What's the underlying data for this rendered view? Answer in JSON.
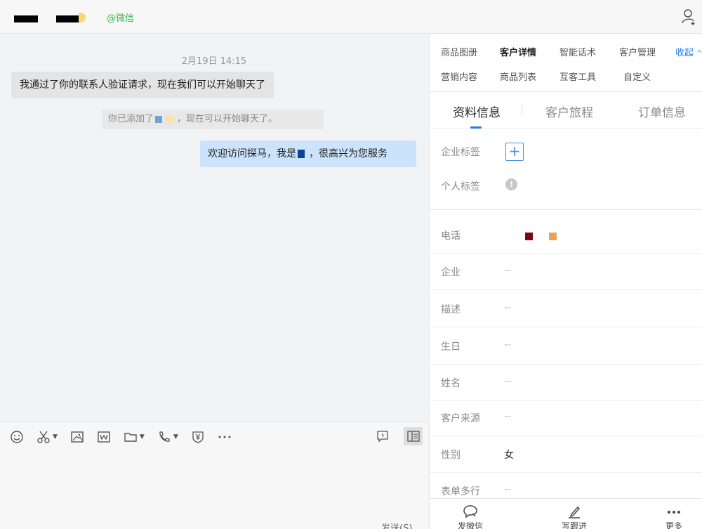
{
  "header": {
    "wechat_tag": "@微信"
  },
  "chat": {
    "timestamp": "2月19日 14:15",
    "messages": [
      {
        "side": "left",
        "text": "我通过了你的联系人验证请求，现在我们可以开始聊天了"
      },
      {
        "side": "system",
        "prefix": "你已添加了",
        "suffix": "，现在可以开始聊天了。"
      },
      {
        "side": "right",
        "prefix": "欢迎访问探马，我是",
        "suffix": "，很高兴为您服务"
      }
    ]
  },
  "input": {
    "send_label": "发送(S)"
  },
  "panel": {
    "top_tabs": [
      {
        "label": "商品图册"
      },
      {
        "label": "客户详情"
      },
      {
        "label": "智能话术"
      },
      {
        "label": "客户管理"
      },
      {
        "label": "营销内容"
      },
      {
        "label": "商品列表"
      },
      {
        "label": "互客工具"
      },
      {
        "label": "自定义"
      }
    ],
    "collapse_label": "收起",
    "sub_tabs": [
      {
        "label": "资料信息"
      },
      {
        "label": "客户旅程"
      },
      {
        "label": "订单信息"
      }
    ],
    "tags": {
      "enterprise_label": "企业标签",
      "personal_label": "个人标签",
      "info_icon_glyph": "!"
    },
    "fields": [
      {
        "label": "电话",
        "value": ""
      },
      {
        "label": "企业",
        "value": "--"
      },
      {
        "label": "描述",
        "value": "--"
      },
      {
        "label": "生日",
        "value": "--"
      },
      {
        "label": "姓名",
        "value": "--"
      },
      {
        "label": "客户来源",
        "value": "--"
      },
      {
        "label": "性别",
        "value": "女"
      },
      {
        "label": "表单多行",
        "value": "--"
      }
    ],
    "bottom_actions": [
      {
        "label": "发微信"
      },
      {
        "label": "写跟进"
      },
      {
        "label": "更多"
      }
    ]
  },
  "colors": {
    "accent": "#1f7ce6",
    "wechat_green": "#3bb34a",
    "bubble_right": "#cce4fb",
    "bubble_left": "#e4e4e4"
  }
}
